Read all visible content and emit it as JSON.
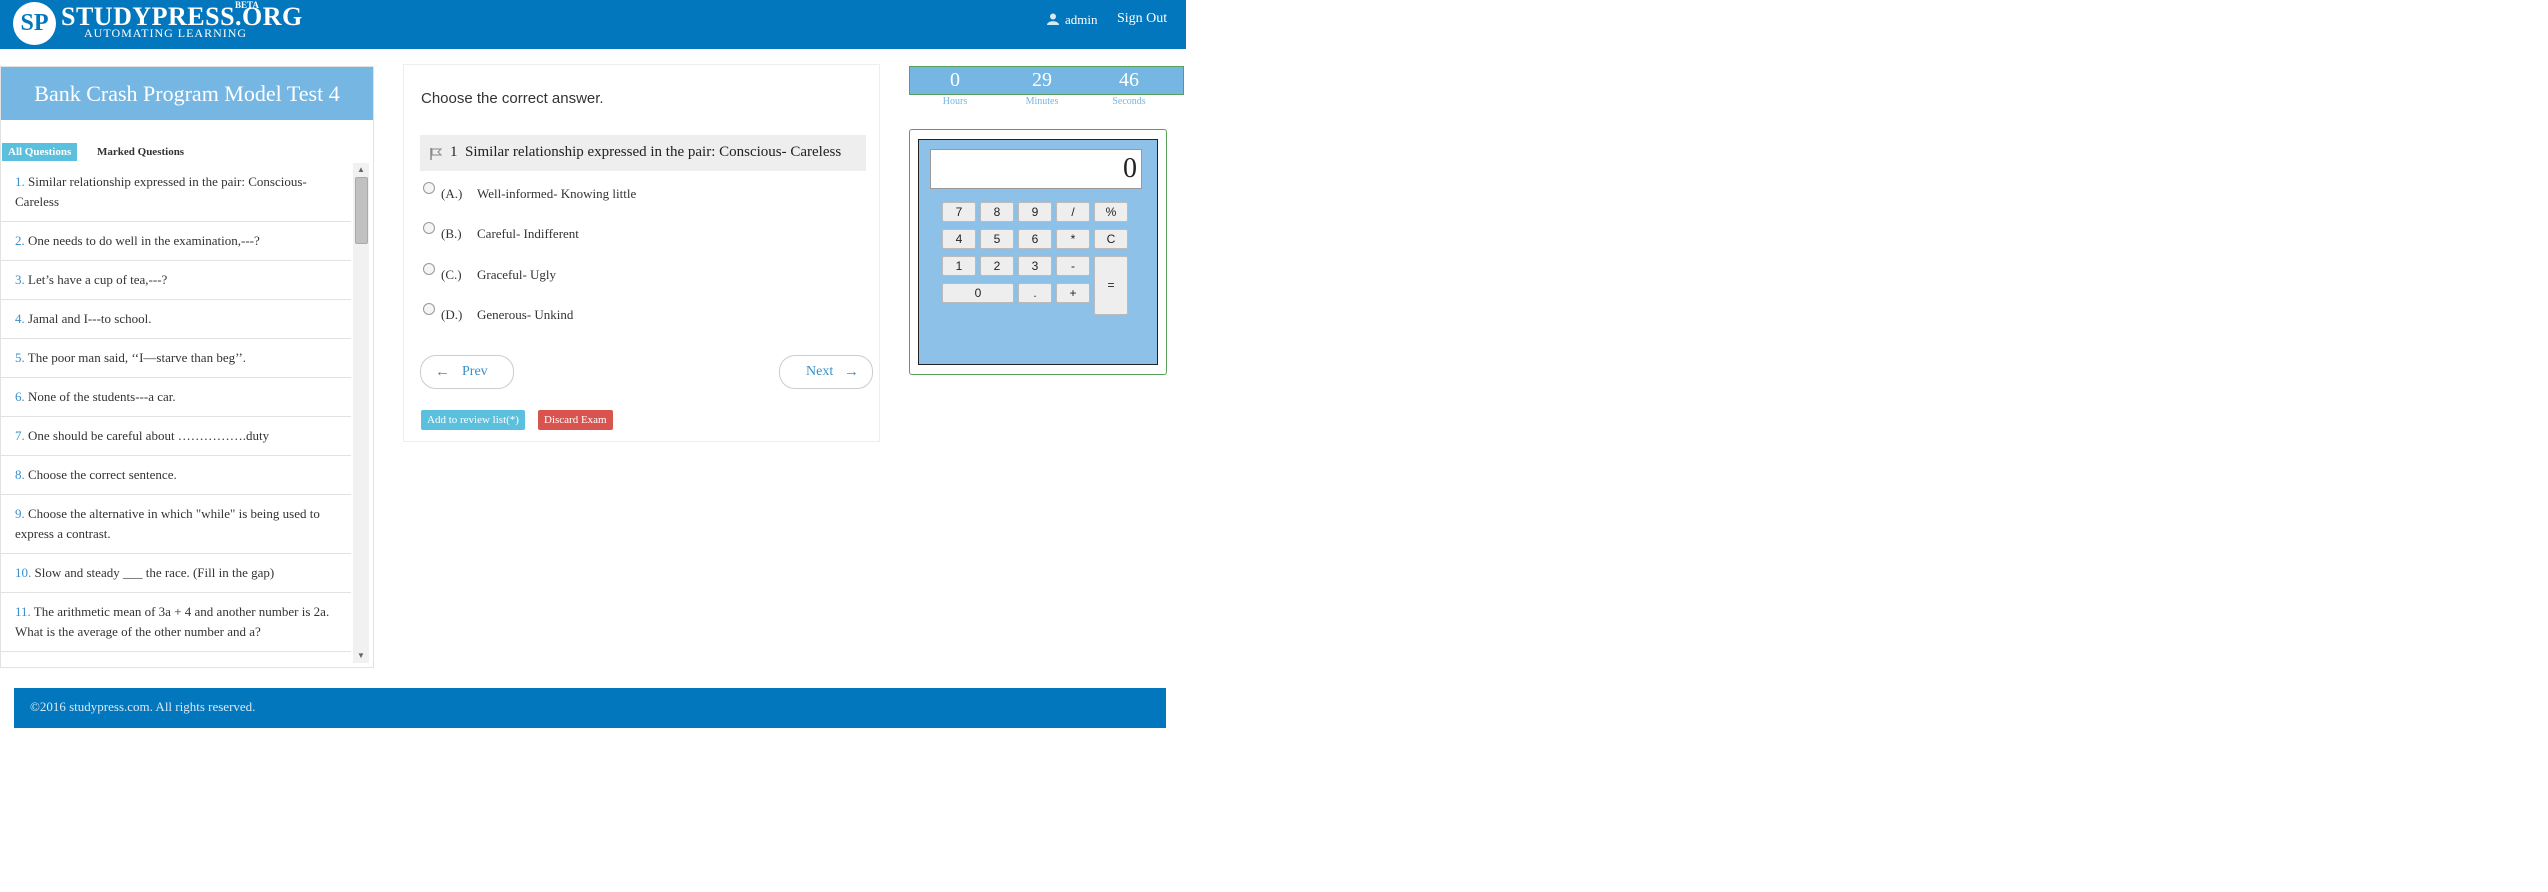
{
  "header": {
    "logo_mark": "SP",
    "logo_name": "STUDYPRESS.ORG",
    "logo_beta": "BETA",
    "logo_tagline": "AUTOMATING LEARNING",
    "username": "admin",
    "sign_out": "Sign Out"
  },
  "left": {
    "title": "Bank Crash Program Model Test 4",
    "tab_all": "All Questions",
    "tab_marked": "Marked Questions",
    "questions": [
      {
        "num": "1.",
        "text": "Similar relationship expressed in the pair: Conscious- Careless"
      },
      {
        "num": "2.",
        "text": "One needs to do well in the examination,---?"
      },
      {
        "num": "3.",
        "text": "Let’s have a cup of tea,---?"
      },
      {
        "num": "4.",
        "text": "Jamal and I---to school."
      },
      {
        "num": "5.",
        "text": "The poor man said, ‘‘I—starve than beg’’."
      },
      {
        "num": "6.",
        "text": "None of the students---a car."
      },
      {
        "num": "7.",
        "text": "One should be careful about …………….duty"
      },
      {
        "num": "8.",
        "text": " Choose the correct sentence."
      },
      {
        "num": "9.",
        "text": "Choose the alternative in which \"while\" is being used to express a contrast."
      },
      {
        "num": "10.",
        "text": "Slow and steady ___ the race. (Fill in the gap)"
      },
      {
        "num": "11.",
        "text": "The arithmetic mean of 3a + 4 and another number is 2a. What is the average of the other number and a?"
      }
    ]
  },
  "main": {
    "instruction": "Choose the correct answer.",
    "question_number": "1",
    "question_text": "Similar relationship expressed in the pair: Conscious- Careless",
    "options": [
      {
        "letter": "(A.)",
        "text": "Well-informed- Knowing little"
      },
      {
        "letter": "(B.)",
        "text": "Careful- Indifferent"
      },
      {
        "letter": "(C.)",
        "text": "Graceful- Ugly"
      },
      {
        "letter": "(D.)",
        "text": "Generous- Unkind"
      }
    ],
    "prev_label": "Prev",
    "next_label": "Next",
    "review_label": "Add to review list(*)",
    "discard_label": "Discard Exam"
  },
  "timer": {
    "hours": "0",
    "minutes": "29",
    "seconds": "46",
    "hours_label": "Hours",
    "minutes_label": "Minutes",
    "seconds_label": "Seconds"
  },
  "calculator": {
    "display": "0",
    "keys": [
      "7",
      "8",
      "9",
      "/",
      "%",
      "4",
      "5",
      "6",
      "*",
      "C",
      "1",
      "2",
      "3",
      "-",
      "=",
      "0",
      ".",
      "+"
    ]
  },
  "footer": {
    "copyright": "©2016 studypress.com. All rights reserved."
  },
  "colors": {
    "brand": "#0277bd",
    "light_blue": "#76b6e3",
    "info": "#5bc0de",
    "danger": "#d9534f"
  }
}
